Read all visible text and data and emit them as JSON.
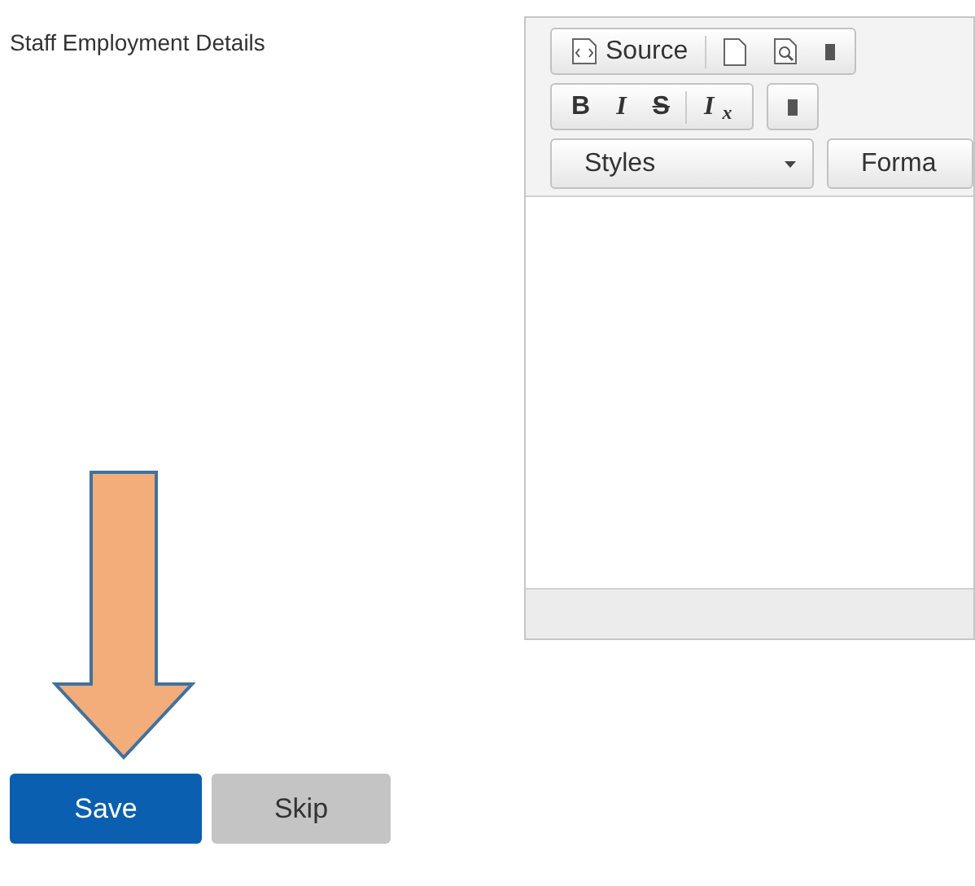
{
  "field_label": "Staff Employment Details",
  "editor": {
    "toolbar_rows": [
      {
        "groups": [
          [
            {
              "kind": "source",
              "label": "Source"
            },
            {
              "kind": "separator"
            },
            {
              "kind": "newpage"
            },
            {
              "kind": "preview"
            },
            {
              "kind": "cut"
            }
          ]
        ]
      },
      {
        "groups": [
          [
            {
              "kind": "bold",
              "label": "B"
            },
            {
              "kind": "italic",
              "label": "I"
            },
            {
              "kind": "strike",
              "label": "S"
            },
            {
              "kind": "separator"
            },
            {
              "kind": "italic",
              "label": "I$_{x}$"
            }
          ],
          [
            {
              "kind": "cut"
            }
          ]
        ]
      },
      {
        "dropdowns": [
          {
            "label": "Styles",
            "kind": "select"
          },
          {
            "label": "Forma",
            "kind": "partial"
          }
        ]
      }
    ]
  },
  "buttons": [
    {
      "label": "Save",
      "kind": "primary"
    },
    {
      "label": "Skip",
      "kind": "secondary"
    }
  ]
}
